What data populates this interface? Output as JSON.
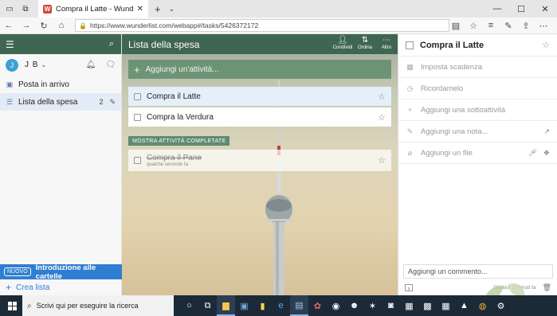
{
  "browser": {
    "tab_title": "Compra il Latte - Wund",
    "tab_favicon": "wunderlist-icon",
    "url": "https://www.wunderlist.com/webapp#/tasks/5426372172"
  },
  "sidebar": {
    "user_initial": "J",
    "user_name": "J B",
    "items": [
      {
        "label": "Posta in arrivo",
        "icon": "inbox-icon"
      },
      {
        "label": "Lista della spesa",
        "icon": "list-icon",
        "count": "2"
      }
    ],
    "promo_badge": "NUOVO",
    "promo_text": "Introduzione alle cartelle",
    "new_list": "Crea lista"
  },
  "main": {
    "title": "Lista della spesa",
    "actions": [
      {
        "label": "Condividi",
        "icon": "share-icon"
      },
      {
        "label": "Ordina",
        "icon": "sort-icon"
      },
      {
        "label": "Altro",
        "icon": "more-icon"
      }
    ],
    "add_placeholder": "Aggiungi un'attività...",
    "tasks": [
      {
        "title": "Compra il Latte"
      },
      {
        "title": "Compra la Verdura"
      }
    ],
    "completed_label": "MOSTRA ATTIVITÀ COMPLETATE",
    "completed_task": {
      "title": "Compra il Pane",
      "meta": "qualche secondo fa"
    }
  },
  "detail": {
    "title": "Compra il Latte",
    "rows": [
      {
        "label": "Imposta scadenza",
        "icon": "calendar-icon"
      },
      {
        "label": "Ricordamelo",
        "icon": "alarm-icon"
      },
      {
        "label": "Aggiungi una sottoattività",
        "icon": "plus-icon"
      },
      {
        "label": "Aggiungi una nota...",
        "icon": "pencil-icon"
      },
      {
        "label": "Aggiungi un file",
        "icon": "paperclip-icon"
      }
    ],
    "comment_placeholder": "Aggiungi un commento...",
    "created": "Creato: 2 minuti fa"
  },
  "taskbar": {
    "search_placeholder": "Scrivi qui per eseguire la ricerca"
  },
  "colors": {
    "header_green": "#3f6651",
    "accent_blue": "#2f7ed1",
    "selected_task": "#e4eff9"
  }
}
